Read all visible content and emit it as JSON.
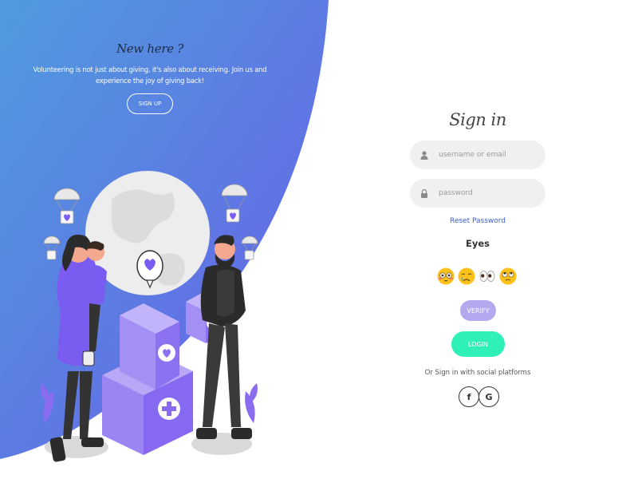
{
  "promo": {
    "heading": "New here ?",
    "text": "Volunteering is not just about giving, it's also about receiving. Join us and experience the joy of giving back!",
    "signup_label": "SIGN UP"
  },
  "form": {
    "title": "Sign in",
    "username_placeholder": "username or email",
    "password_placeholder": "password",
    "reset_label": "Reset Password",
    "eyes_label": "Eyes",
    "verify_label": "VERIFY",
    "login_label": "LOGIN",
    "social_text": "Or Sign in with social platforms",
    "facebook_label": "f",
    "google_label": "G"
  },
  "emojis": [
    "flushed-face",
    "crying-face",
    "eyes",
    "face-with-rolling-eyes"
  ],
  "colors": {
    "gradient_start": "#4f9bde",
    "gradient_end": "#6a5de8",
    "accent_purple": "#8b6cf0",
    "verify": "#b3a9ee",
    "login": "#2ff0b6",
    "reset_link": "#3b5ec9"
  }
}
